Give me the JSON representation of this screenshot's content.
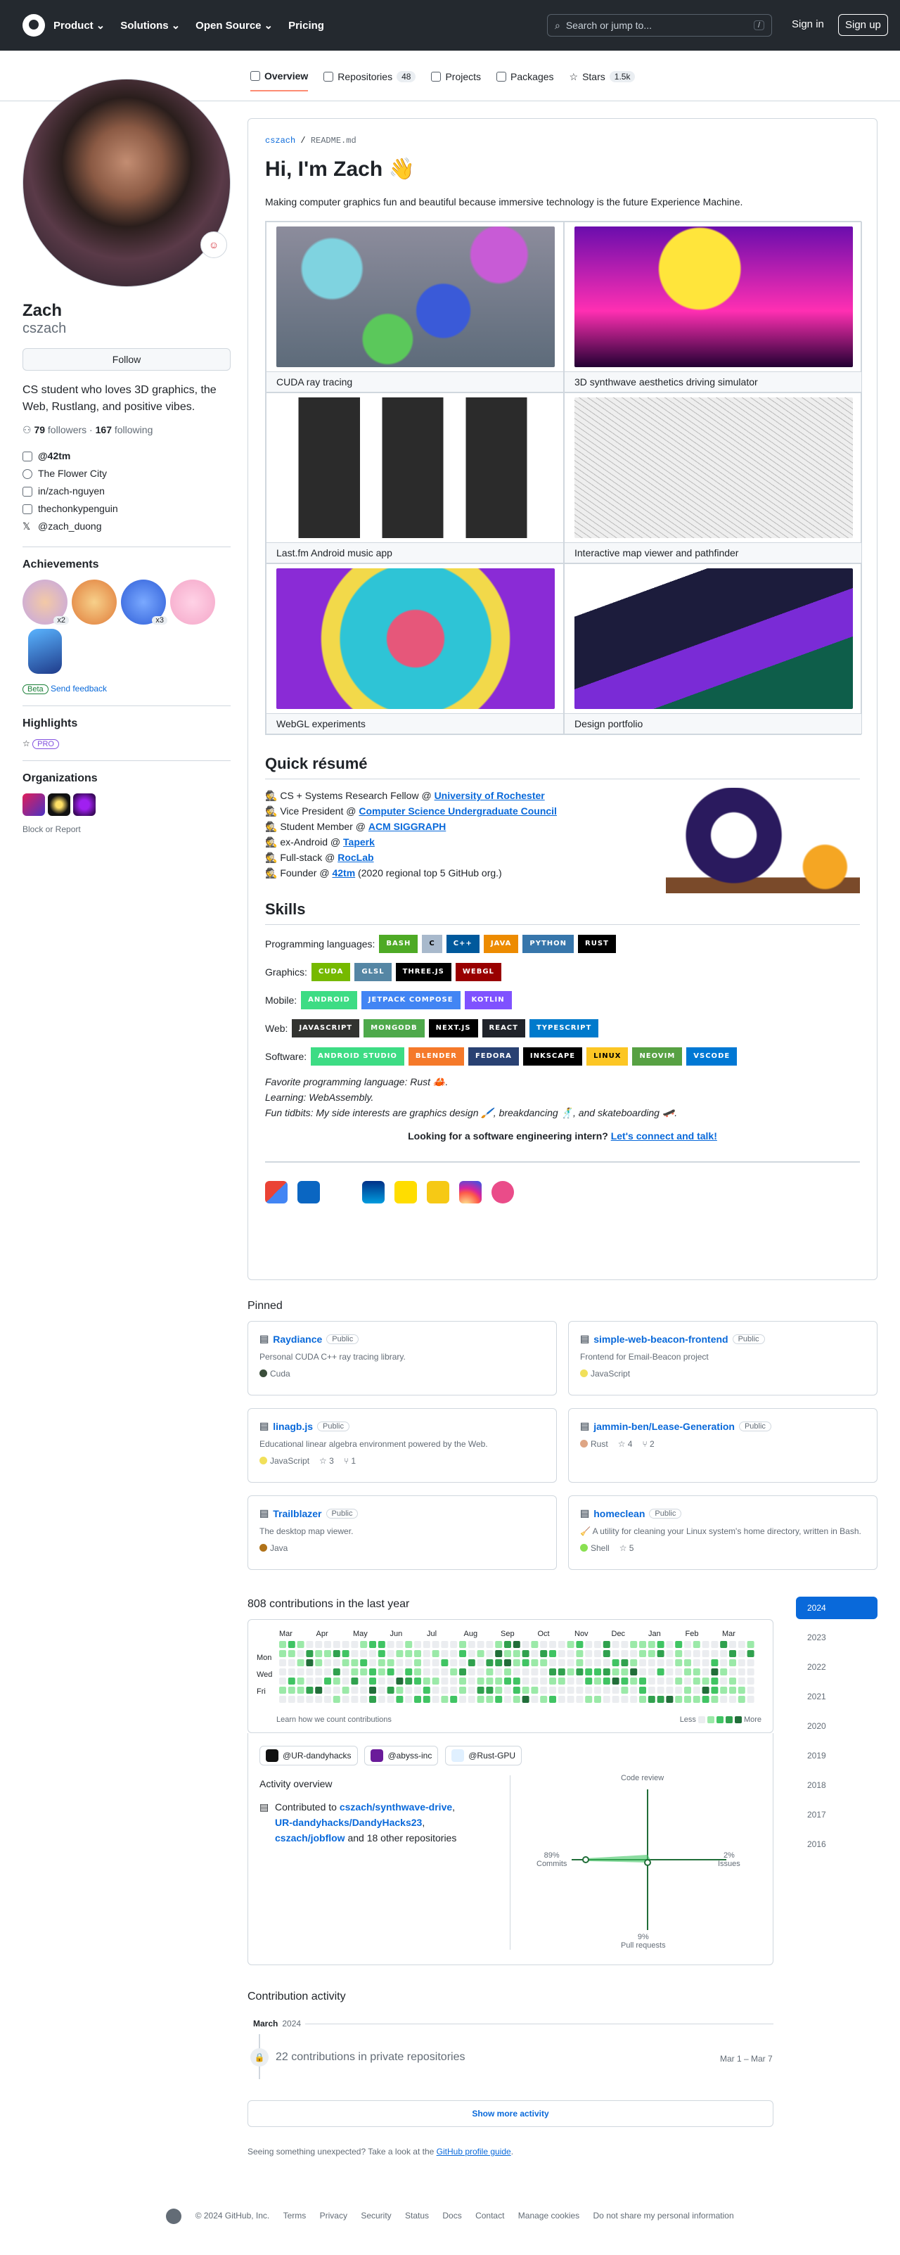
{
  "header": {
    "nav": [
      "Product",
      "Solutions",
      "Open Source",
      "Pricing"
    ],
    "search_placeholder": "Search or jump to...",
    "search_key": "/",
    "signin": "Sign in",
    "signup": "Sign up"
  },
  "tabs": [
    {
      "label": "Overview"
    },
    {
      "label": "Repositories",
      "count": "48"
    },
    {
      "label": "Projects"
    },
    {
      "label": "Packages"
    },
    {
      "label": "Stars",
      "count": "1.5k"
    }
  ],
  "profile": {
    "name": "Zach",
    "username": "cszach",
    "follow": "Follow",
    "bio": "CS student who loves 3D graphics, the Web, Rustlang, and positive vibes.",
    "followers": "79",
    "followers_label": "followers",
    "following": "167",
    "following_label": "following",
    "org": "@42tm",
    "location": "The Flower City",
    "linkedin": "in/zach-nguyen",
    "mastodon": "thechonkypenguin",
    "x": "@zach_duong"
  },
  "achievements": {
    "title": "Achievements",
    "x2": "x2",
    "x3": "x3",
    "beta": "Beta",
    "feedback": "Send feedback"
  },
  "highlights": {
    "title": "Highlights",
    "pro": "PRO"
  },
  "organizations": {
    "title": "Organizations",
    "block": "Block or Report"
  },
  "readme": {
    "path_user": "cszach",
    "path_file": "README",
    "path_ext": ".md",
    "title": "Hi, I'm Zach 👋",
    "intro": "Making computer graphics fun and beautiful because immersive technology is the future Experience Machine.",
    "gallery": [
      "CUDA ray tracing",
      "3D synthwave aesthetics driving simulator",
      "Last.fm Android music app",
      "Interactive map viewer and pathfinder",
      "WebGL experiments",
      "Design portfolio"
    ],
    "resume_title": "Quick résumé",
    "resume": [
      {
        "pre": "CS + Systems Research Fellow @ ",
        "link": "University of Rochester",
        "post": ""
      },
      {
        "pre": "Vice President @ ",
        "link": "Computer Science Undergraduate Council",
        "post": ""
      },
      {
        "pre": "Student Member @ ",
        "link": "ACM SIGGRAPH",
        "post": ""
      },
      {
        "pre": "ex-Android @ ",
        "link": "Taperk",
        "post": ""
      },
      {
        "pre": "Full-stack @ ",
        "link": "RocLab",
        "post": ""
      },
      {
        "pre": "Founder @ ",
        "link": "42tm",
        "post": " (2020 regional top 5 GitHub org.)"
      }
    ],
    "skills_title": "Skills",
    "skills": [
      {
        "label": "Programming languages:",
        "badges": [
          {
            "t": "BASH",
            "c": "#4eaa25"
          },
          {
            "t": "C",
            "c": "#a8b9cc"
          },
          {
            "t": "C++",
            "c": "#00599c"
          },
          {
            "t": "JAVA",
            "c": "#ed8b00"
          },
          {
            "t": "PYTHON",
            "c": "#3776ab"
          },
          {
            "t": "RUST",
            "c": "#000000"
          }
        ]
      },
      {
        "label": "Graphics:",
        "badges": [
          {
            "t": "CUDA",
            "c": "#76b900"
          },
          {
            "t": "GLSL",
            "c": "#5586a4"
          },
          {
            "t": "THREE.JS",
            "c": "#000000"
          },
          {
            "t": "WEBGL",
            "c": "#990000"
          }
        ]
      },
      {
        "label": "Mobile:",
        "badges": [
          {
            "t": "ANDROID",
            "c": "#3ddc84"
          },
          {
            "t": "JETPACK COMPOSE",
            "c": "#4285f4"
          },
          {
            "t": "KOTLIN",
            "c": "#7f52ff"
          }
        ]
      },
      {
        "label": "Web:",
        "badges": [
          {
            "t": "JAVASCRIPT",
            "c": "#323330"
          },
          {
            "t": "MONGODB",
            "c": "#4ea94b"
          },
          {
            "t": "NEXT.JS",
            "c": "#000000"
          },
          {
            "t": "REACT",
            "c": "#20232a"
          },
          {
            "t": "TYPESCRIPT",
            "c": "#007acc"
          }
        ]
      },
      {
        "label": "Software:",
        "badges": [
          {
            "t": "ANDROID STUDIO",
            "c": "#3ddc84"
          },
          {
            "t": "BLENDER",
            "c": "#f5792a"
          },
          {
            "t": "FEDORA",
            "c": "#294172"
          },
          {
            "t": "INKSCAPE",
            "c": "#000000"
          },
          {
            "t": "LINUX",
            "c": "#fcc624"
          },
          {
            "t": "NEOVIM",
            "c": "#57a143"
          },
          {
            "t": "VSCODE",
            "c": "#0078d4"
          }
        ]
      }
    ],
    "fav": "Favorite programming language: Rust 🦀.",
    "learning": "Learning: WebAssembly.",
    "tidbits": "Fun tidbits: My side interests are graphics design 🖌️, breakdancing 🕺, and skateboarding 🛹.",
    "cta_text": "Looking for a software engineering intern? ",
    "cta_link": "Let's connect and talk!"
  },
  "pinned": {
    "title": "Pinned",
    "public": "Public",
    "items": [
      {
        "name": "Raydiance",
        "desc": "Personal CUDA C++ ray tracing library.",
        "lang": "Cuda",
        "color": "#3a4e3a",
        "stars": "",
        "forks": ""
      },
      {
        "name": "simple-web-beacon-frontend",
        "desc": "Frontend for Email-Beacon project",
        "lang": "JavaScript",
        "color": "#f1e05a",
        "stars": "",
        "forks": ""
      },
      {
        "name": "linagb.js",
        "desc": "Educational linear algebra environment powered by the Web.",
        "lang": "JavaScript",
        "color": "#f1e05a",
        "stars": "3",
        "forks": "1"
      },
      {
        "name": "jammin-ben/Lease-Generation",
        "desc": "",
        "lang": "Rust",
        "color": "#dea584",
        "stars": "4",
        "forks": "2"
      },
      {
        "name": "Trailblazer",
        "desc": "The desktop map viewer.",
        "lang": "Java",
        "color": "#b07219",
        "stars": "",
        "forks": ""
      },
      {
        "name": "homeclean",
        "desc": "🧹 A utility for cleaning your Linux system's home directory, written in Bash.",
        "lang": "Shell",
        "color": "#89e051",
        "stars": "5",
        "forks": ""
      }
    ]
  },
  "contrib": {
    "title": "808 contributions in the last year",
    "months": [
      "Mar",
      "Apr",
      "May",
      "Jun",
      "Jul",
      "Aug",
      "Sep",
      "Oct",
      "Nov",
      "Dec",
      "Jan",
      "Feb",
      "Mar"
    ],
    "days": [
      "Mon",
      "Wed",
      "Fri"
    ],
    "learn": "Learn how we count contributions",
    "less": "Less",
    "more": "More",
    "years": [
      "2024",
      "2023",
      "2022",
      "2021",
      "2020",
      "2019",
      "2018",
      "2017",
      "2016"
    ]
  },
  "activity": {
    "orgs": [
      "@UR-dandyhacks",
      "@abyss-inc",
      "@Rust-GPU"
    ],
    "overview": "Activity overview",
    "contributed_pre": "Contributed to ",
    "repo1": "cszach/synthwave-drive",
    "repo2": "UR-dandyhacks/DandyHacks23",
    "repo3": "cszach/jobflow",
    "contributed_post": " and 18 other repositories",
    "code_review": "Code review",
    "commits_pct": "89%",
    "commits": "Commits",
    "issues_pct": "2%",
    "issues": "Issues",
    "prs_pct": "9%",
    "prs": "Pull requests"
  },
  "contrib_activity": {
    "title": "Contribution activity",
    "month": "March",
    "year": "2024",
    "private": "22 contributions in private repositories",
    "range": "Mar 1 – Mar 7",
    "more": "Show more activity",
    "note_pre": "Seeing something unexpected? Take a look at the ",
    "note_link": "GitHub profile guide",
    "note_post": "."
  },
  "footer": [
    "© 2024 GitHub, Inc.",
    "Terms",
    "Privacy",
    "Security",
    "Status",
    "Docs",
    "Contact",
    "Manage cookies",
    "Do not share my personal information"
  ],
  "colors": {
    "accent": "#0969da",
    "header": "#24292f",
    "green": "#1a7f37"
  }
}
